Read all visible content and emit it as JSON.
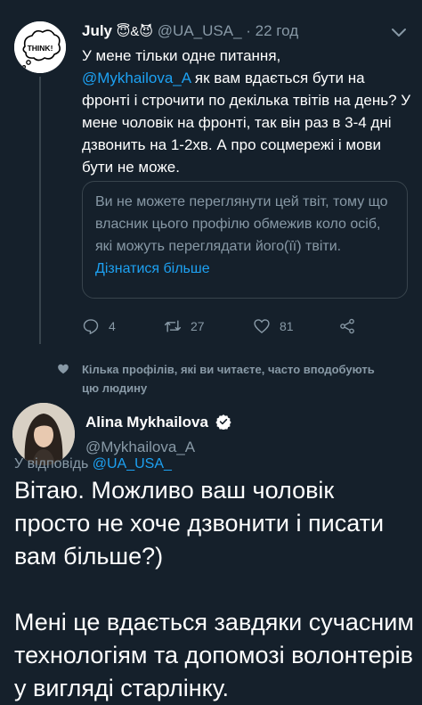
{
  "tweet1": {
    "name": "July",
    "name_emojis": "😇&😈",
    "handle": "@UA_USA_",
    "separator": "·",
    "time": "22 год",
    "avatar_text": "THINK!",
    "text_line1": "У мене тільки одне питання,",
    "mention": "@Mykhailova_A",
    "text_rest": " як вам вдається бути на фронті і строчити по декілька твітів на день? У мене чоловік на фронті, так він раз в 3-4 дні дзвонить на 1-2хв. А про соцмережі і мови бути не може.",
    "restricted_text": "Ви не можете переглянути цей твіт, тому що власник цього профілю обмежив коло осіб, які можуть переглядати його(її) твіти.",
    "restricted_link": "Дізнатися більше",
    "replies": "4",
    "retweets": "27",
    "likes": "81"
  },
  "social_context": {
    "line1": "Кілька профілів, які ви читаєте, часто вподобують",
    "line2": "цю людину"
  },
  "tweet2": {
    "name": "Alina Mykhailova",
    "handle": "@Mykhailova_A",
    "reply_prefix": "У відповідь",
    "reply_mention": "@UA_USA_",
    "paragraph1": "Вітаю. Можливо ваш чоловік просто не хоче дзвонити і писати вам більше?)",
    "paragraph2": "Мені це вдається завдяки сучасним технологіям та допомозі волонтерів у вигляді старлінку."
  },
  "colors": {
    "background": "#15202b",
    "accent": "#1da1f2",
    "muted": "#8899a6"
  }
}
